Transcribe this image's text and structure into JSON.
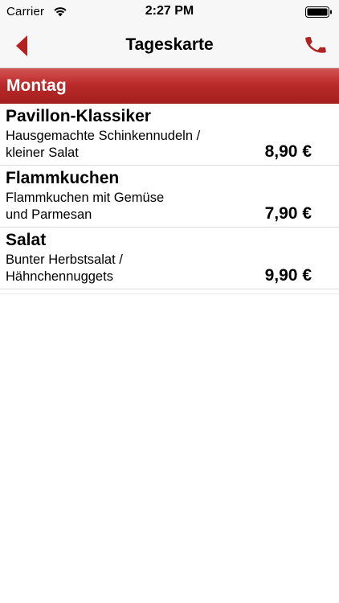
{
  "status_bar": {
    "carrier": "Carrier",
    "time": "2:27 PM",
    "wifi_icon": "wifi-icon",
    "battery_icon": "battery-icon"
  },
  "nav": {
    "title": "Tageskarte",
    "back_icon": "chevron-left-icon",
    "phone_icon": "phone-icon",
    "accent_color": "#b22222"
  },
  "section": {
    "title": "Montag",
    "color": "#b32423"
  },
  "menu_items": [
    {
      "name": "Pavillon-Klassiker",
      "desc_line1": "Hausgemachte Schinkennudeln /",
      "desc_line2": "kleiner Salat",
      "price": "8,90 €"
    },
    {
      "name": "Flammkuchen",
      "desc_line1": "Flammkuchen mit Gemüse",
      "desc_line2": "und Parmesan",
      "price": "7,90 €"
    },
    {
      "name": "Salat",
      "desc_line1": "Bunter Herbstsalat /",
      "desc_line2": "Hähnchennuggets",
      "price": "9,90 €"
    }
  ]
}
